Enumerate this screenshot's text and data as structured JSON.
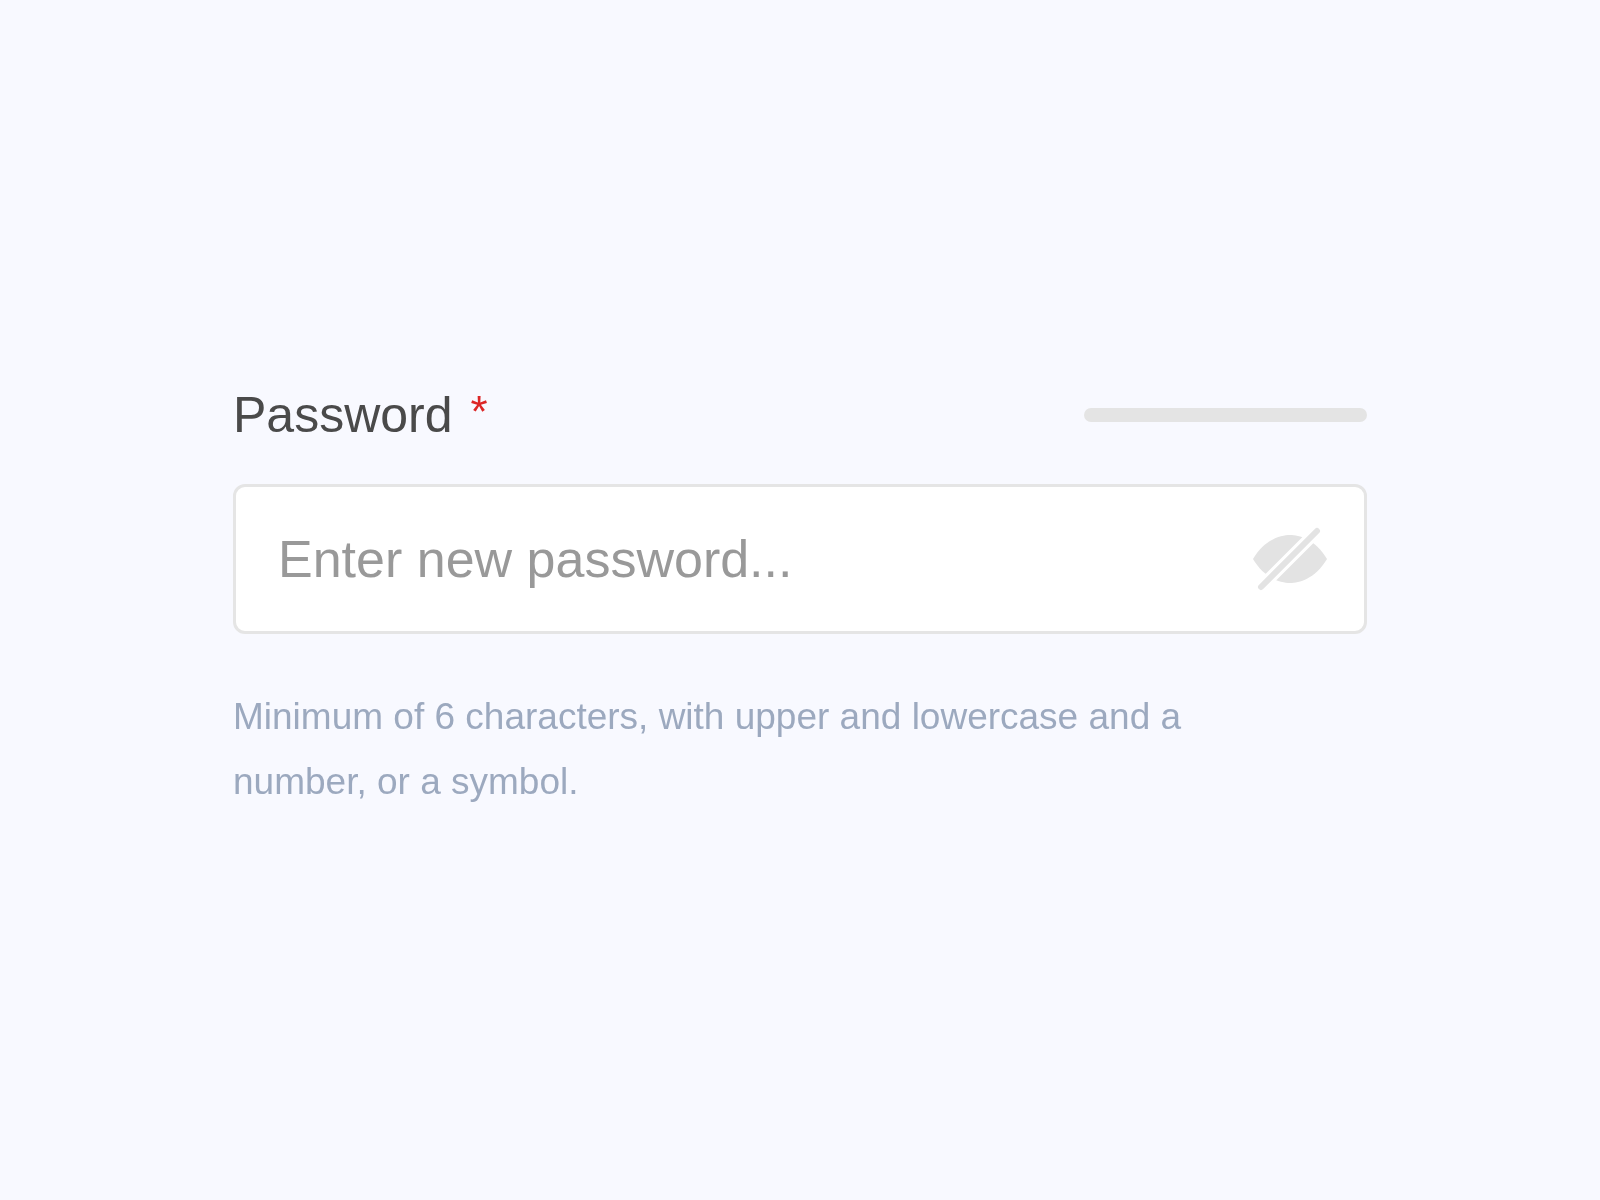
{
  "field": {
    "label": "Password",
    "required_mark": "*",
    "placeholder": "Enter new password...",
    "password_visible": false,
    "help": "Minimum of 6 characters, with upper and lowercase and a number, or a symbol."
  }
}
